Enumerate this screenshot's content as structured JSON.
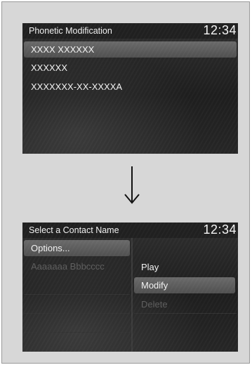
{
  "screen1": {
    "title": "Phonetic Modification",
    "clock": "12:34",
    "items": [
      {
        "label": "XXXX XXXXXX",
        "selected": true
      },
      {
        "label": "XXXXXX",
        "selected": false
      },
      {
        "label": "XXXXXXX-XX-XXXXA",
        "selected": false
      }
    ]
  },
  "screen2": {
    "title": "Select a Contact Name",
    "clock": "12:34",
    "left_items": [
      {
        "label": "Options...",
        "selected": true
      },
      {
        "label": "Aaaaaaa Bbbcccc",
        "disabled": true
      }
    ],
    "menu": [
      {
        "label": "Play",
        "selected": false
      },
      {
        "label": "Modify",
        "selected": true
      },
      {
        "label": "Delete",
        "disabled": true
      }
    ]
  },
  "arrow_icon": "down-arrow-icon",
  "colors": {
    "screen_bg": "#262626",
    "highlight": "#5e5e5e",
    "text": "#f2f2f2",
    "disabled_text": "#5e5e5e",
    "panel_bg": "#d7d7d7"
  }
}
